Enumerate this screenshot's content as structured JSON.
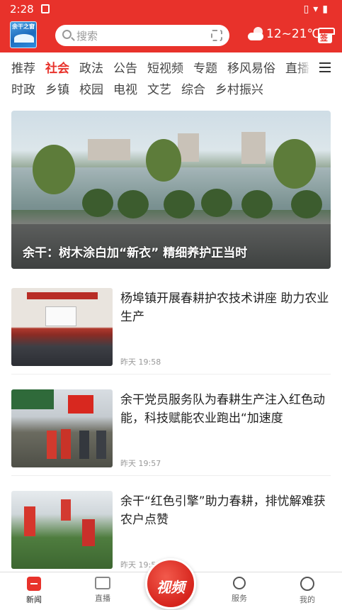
{
  "status_bar": {
    "time": "2:28"
  },
  "header": {
    "logo_text": "余干之窗",
    "search_placeholder": "搜索",
    "weather": "12~21℃",
    "checkin_label": "签"
  },
  "tabs": {
    "row1": [
      "推荐",
      "社会",
      "政法",
      "公告",
      "短视频",
      "专题",
      "移风易俗",
      "直播"
    ],
    "row2": [
      "时政",
      "乡镇",
      "校园",
      "电视",
      "文艺",
      "综合",
      "乡村振兴"
    ],
    "active": "社会"
  },
  "hero": {
    "caption": "余干：树木涂白加“新衣” 精细养护正当时"
  },
  "news": [
    {
      "title": "杨埠镇开展春耕护农技术讲座 助力农业生产",
      "time": "昨天 19:58"
    },
    {
      "title": "余干党员服务队为春耕生产注入红色动能，科技赋能农业跑出“加速度",
      "time": "昨天 19:57"
    },
    {
      "title": "余干“红色引擎”助力春耕，排忧解难获农户点赞",
      "time": "昨天 19:5"
    }
  ],
  "bottom_nav": {
    "items": [
      "新闻",
      "直播",
      "服务",
      "我的"
    ],
    "video_label": "视频",
    "active": "新闻"
  },
  "colors": {
    "brand_red": "#e8322b"
  }
}
